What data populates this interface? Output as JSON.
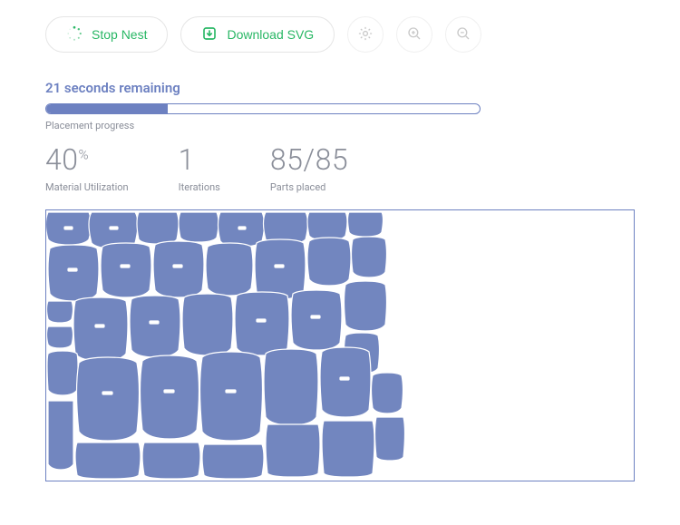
{
  "toolbar": {
    "stop_label": "Stop Nest",
    "download_label": "Download SVG"
  },
  "status": {
    "remaining_text": "21 seconds remaining",
    "progress_percent": 28,
    "progress_label": "Placement progress"
  },
  "metrics": {
    "utilization_value": "40",
    "utilization_pct": "%",
    "utilization_label": "Material Utilization",
    "iterations_value": "1",
    "iterations_label": "Iterations",
    "parts_value": "85/85",
    "parts_label": "Parts placed"
  },
  "colors": {
    "primary": "#6d81c1",
    "part_fill": "#7286bf",
    "accent": "#29b765"
  }
}
